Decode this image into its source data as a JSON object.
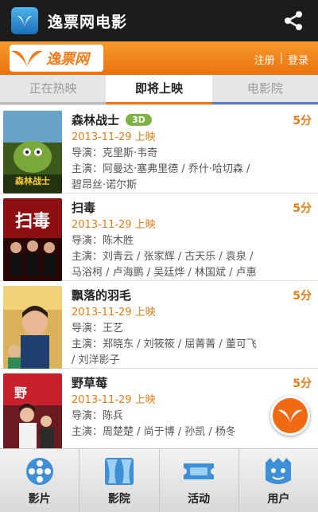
{
  "app": {
    "title": "逸票网电影",
    "icon": "app-logo-icon",
    "share_icon": "share-icon"
  },
  "brand": {
    "logo_text": "逸票网",
    "register": "注册",
    "separator": "|",
    "login": "登录",
    "color": "#ef7b19"
  },
  "tabs": [
    {
      "label": "正在热映",
      "active": false
    },
    {
      "label": "即将上映",
      "active": true
    },
    {
      "label": "电影院",
      "active": false
    }
  ],
  "movies": [
    {
      "title": "森林战士",
      "badge": "3D",
      "score": "5分",
      "date": "2013-11-29 上映",
      "director": "导演：克里斯·韦奇",
      "cast_line1": "主演：阿曼达·塞弗里德 / 乔什·哈切森 /",
      "cast_line2": "碧昂丝·诺尔斯",
      "poster_text": "森林战士"
    },
    {
      "title": "扫毒",
      "badge": "",
      "score": "5分",
      "date": "2013-11-29 上映",
      "director": "导演：陈木胜",
      "cast_line1": "主演：刘青云 / 张家辉 / 古天乐 / 袁泉 /",
      "cast_line2": "马浴柯 / 卢海鹏 / 吴廷烨 / 林国斌 / 卢惠",
      "poster_text": "扫毒"
    },
    {
      "title": "飘落的羽毛",
      "badge": "",
      "score": "5分",
      "date": "2013-11-29 上映",
      "director": "导演：王艺",
      "cast_line1": "主演：郑晓东 / 刘筱筱 / 屈菁菁 / 董可飞",
      "cast_line2": "/ 刘洋影子",
      "poster_text": ""
    },
    {
      "title": "野草莓",
      "badge": "",
      "score": "5分",
      "date": "2013-11-29 上映",
      "director": "导演：陈兵",
      "cast_line1": "主演：周楚楚 / 尚于博 / 孙凯 / 杨冬",
      "cast_line2": "",
      "poster_text": ""
    }
  ],
  "fab": {
    "icon": "logo-fab-icon"
  },
  "bottom_nav": [
    {
      "label": "影片",
      "icon": "film-reel-icon"
    },
    {
      "label": "影院",
      "icon": "theater-curtain-icon"
    },
    {
      "label": "活动",
      "icon": "ticket-icon"
    },
    {
      "label": "用户",
      "icon": "user-face-icon"
    }
  ]
}
